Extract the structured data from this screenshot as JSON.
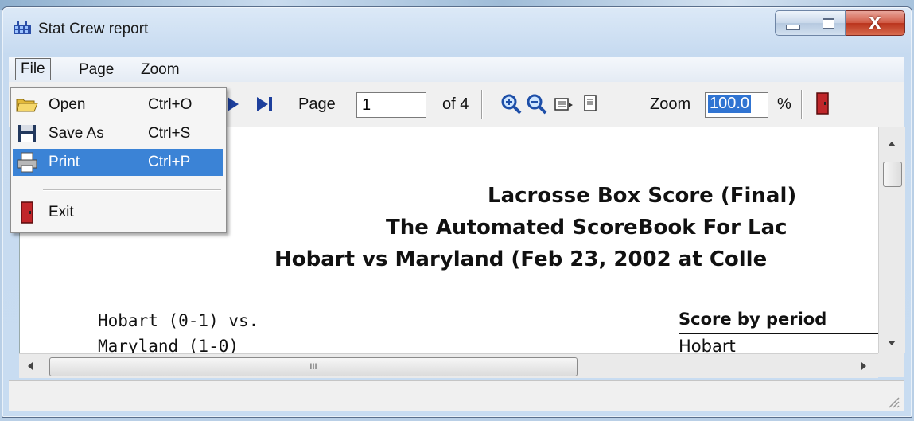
{
  "window": {
    "title": "Stat Crew report",
    "close_glyph": "X"
  },
  "menubar": {
    "file": "File",
    "page": "Page",
    "zoom": "Zoom"
  },
  "file_menu": [
    {
      "label": "Open",
      "shortcut": "Ctrl+O",
      "icon": "folder-open-icon"
    },
    {
      "label": "Save As",
      "shortcut": "Ctrl+S",
      "icon": "floppy-disk-icon"
    },
    {
      "label": "Print",
      "shortcut": "Ctrl+P",
      "icon": "printer-icon",
      "highlighted": true
    },
    {
      "label": "Exit",
      "shortcut": "",
      "icon": "exit-door-icon"
    }
  ],
  "toolbar": {
    "page_label": "Page",
    "page_value": "1",
    "page_of": "of 4",
    "zoom_label": "Zoom",
    "zoom_value": "100.0",
    "zoom_unit": "%"
  },
  "report": {
    "title_line1": "Lacrosse Box Score (Final)",
    "title_line2": "The Automated ScoreBook For Lac",
    "title_line3": "Hobart vs Maryland (Feb 23, 2002 at Colle",
    "team1": "Hobart (0-1) vs.",
    "team2": "Maryland (1-0)",
    "score_heading": "Score by period",
    "score_team1": "Hobart"
  },
  "scrollbar": {
    "h_thumb_grip": "III"
  },
  "colors": {
    "selection": "#3b83d6",
    "zoom_highlight": "#3074d2",
    "close_button": "#c9442c"
  }
}
